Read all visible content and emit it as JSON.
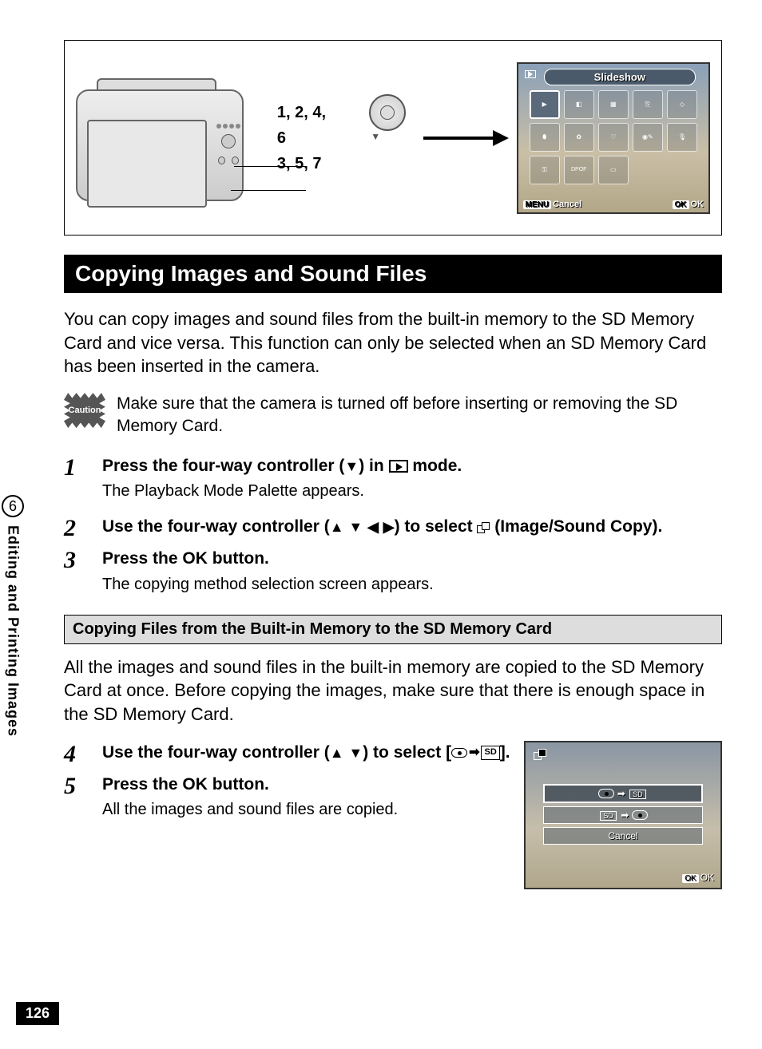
{
  "sidebar": {
    "chapter_number": "6",
    "chapter_label": "Editing and Printing Images"
  },
  "page_number": "126",
  "figure": {
    "labels_top": "1, 2, 4, 6",
    "labels_bottom": "3, 5, 7",
    "screen_title": "Slideshow",
    "menu_label": "MENU",
    "cancel_label": "Cancel",
    "ok_tag": "OK",
    "ok_label": "OK"
  },
  "section_title": "Copying Images and Sound Files",
  "intro_text": "You can copy images and sound files from the built-in memory to the SD Memory Card and vice versa. This function can only be selected when an SD Memory Card has been inserted in the camera.",
  "caution": {
    "badge": "Caution",
    "text": "Make sure that the camera is turned off before inserting or removing the SD Memory Card."
  },
  "steps": {
    "s1": {
      "num": "1",
      "head_a": "Press the four-way controller (",
      "head_b": ") in ",
      "head_c": " mode.",
      "desc": "The Playback Mode Palette appears."
    },
    "s2": {
      "num": "2",
      "head_a": "Use the four-way controller (",
      "head_b": ") to select ",
      "head_c": " (Image/Sound Copy)."
    },
    "s3": {
      "num": "3",
      "head_a": "Press the ",
      "head_b": " button.",
      "ok": "OK",
      "desc": "The copying method selection screen appears."
    }
  },
  "sub_title": "Copying Files from the Built-in Memory to the SD Memory Card",
  "sub_para": "All the images and sound files in the built-in memory are copied to the SD Memory Card at once. Before copying the images, make sure that there is enough space in the SD Memory Card.",
  "steps2": {
    "s4": {
      "num": "4",
      "head_a": "Use the four-way controller (",
      "head_b": ") to select [",
      "head_c": "]."
    },
    "s5": {
      "num": "5",
      "head_a": "Press the ",
      "head_b": " button.",
      "ok": "OK",
      "desc": "All the images and sound files are copied."
    }
  },
  "mini": {
    "sd": "SD",
    "cancel": "Cancel",
    "ok_tag": "OK",
    "ok_label": "OK"
  }
}
